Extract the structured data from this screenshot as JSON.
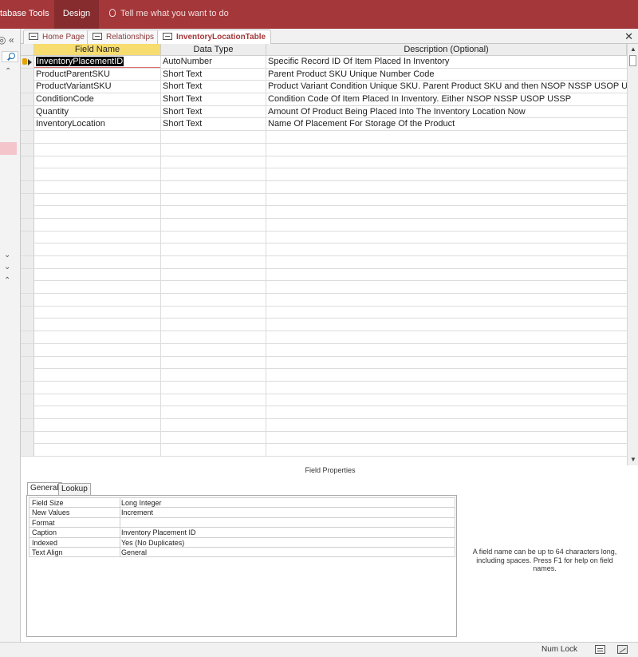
{
  "ribbon": {
    "tabs": [
      {
        "label": "tabase Tools"
      },
      {
        "label": "Design"
      }
    ],
    "tell_me": "Tell me what you want to do",
    "accent_color": "#a4373a"
  },
  "nav_pane": {
    "icons": [
      "open-nav-icon",
      "collapse-icon",
      "search-icon",
      "expand-up-icon",
      "expand-down-icon"
    ]
  },
  "doc_tabs": [
    {
      "label": "Home Page",
      "icon": "form-icon"
    },
    {
      "label": "Relationships",
      "icon": "relationships-icon"
    },
    {
      "label": "InventoryLocationTable",
      "icon": "table-icon",
      "active": true
    }
  ],
  "grid": {
    "headers": {
      "field_name": "Field Name",
      "data_type": "Data Type",
      "description": "Description (Optional)"
    },
    "rows": [
      {
        "field_name": "InventoryPlacementID",
        "data_type": "AutoNumber",
        "description": "Specific Record ID Of Item Placed In Inventory"
      },
      {
        "field_name": "ProductParentSKU",
        "data_type": "Short Text",
        "description": "Parent Product SKU Unique Number Code"
      },
      {
        "field_name": "ProductVariantSKU",
        "data_type": "Short Text",
        "description": "Product Variant Condition Unique SKU. Parent Product SKU and then NSOP NSSP USOP USSP"
      },
      {
        "field_name": "ConditionCode",
        "data_type": "Short Text",
        "description": "Condition Code Of Item Placed In Inventory. Either NSOP NSSP USOP USSP"
      },
      {
        "field_name": "Quantity",
        "data_type": "Short Text",
        "description": "Amount Of Product Being Placed Into The Inventory Location Now"
      },
      {
        "field_name": "InventoryLocation",
        "data_type": "Short Text",
        "description": "Name Of Placement For Storage Of the Product"
      }
    ]
  },
  "field_properties": {
    "title": "Field Properties",
    "tabs": [
      {
        "label": "General"
      },
      {
        "label": "Lookup"
      }
    ],
    "props": [
      {
        "name": "Field Size",
        "value": "Long Integer"
      },
      {
        "name": "New Values",
        "value": "Increment"
      },
      {
        "name": "Format",
        "value": ""
      },
      {
        "name": "Caption",
        "value": "Inventory Placement ID"
      },
      {
        "name": "Indexed",
        "value": "Yes (No Duplicates)"
      },
      {
        "name": "Text Align",
        "value": "General"
      }
    ],
    "help_text": "A field name can be up to 64 characters long, including spaces. Press F1 for help on field names."
  },
  "status_bar": {
    "num_lock": "Num Lock"
  }
}
